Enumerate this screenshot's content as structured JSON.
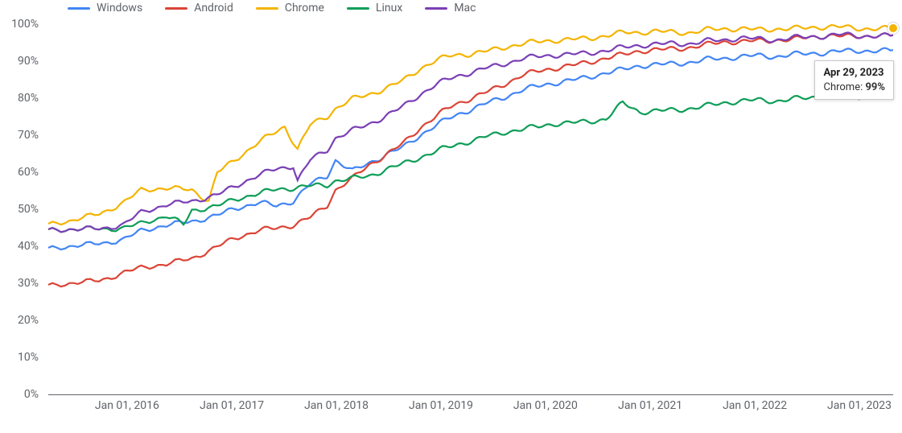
{
  "chart_data": {
    "type": "line",
    "xlabel": "",
    "ylabel": "",
    "ylim": [
      0,
      100
    ],
    "y_ticks": [
      "0%",
      "10%",
      "20%",
      "30%",
      "40%",
      "50%",
      "60%",
      "70%",
      "80%",
      "90%",
      "100%"
    ],
    "x_ticks": [
      "Jan 01, 2016",
      "Jan 01, 2017",
      "Jan 01, 2018",
      "Jan 01, 2019",
      "Jan 01, 2020",
      "Jan 01, 2021",
      "Jan 01, 2022",
      "Jan 01, 2023"
    ],
    "x_range": [
      "2015-04-01",
      "2023-04-29"
    ],
    "colors": {
      "Windows": "#4285F4",
      "Android": "#DB4437",
      "Chrome": "#F4B400",
      "Linux": "#0F9D58",
      "Mac": "#7B3FB5"
    },
    "legend": [
      "Windows",
      "Android",
      "Chrome",
      "Linux",
      "Mac"
    ],
    "series": [
      {
        "name": "Windows",
        "color": "#4285F4",
        "values": [
          [
            0.0,
            39
          ],
          [
            0.03,
            40
          ],
          [
            0.06,
            41
          ],
          [
            0.09,
            42
          ],
          [
            0.11,
            44
          ],
          [
            0.14,
            45.5
          ],
          [
            0.17,
            47
          ],
          [
            0.2,
            48.5
          ],
          [
            0.22,
            50
          ],
          [
            0.25,
            51.5
          ],
          [
            0.27,
            51
          ],
          [
            0.29,
            52.5
          ],
          [
            0.31,
            57
          ],
          [
            0.33,
            59
          ],
          [
            0.34,
            63
          ],
          [
            0.36,
            60
          ],
          [
            0.38,
            62.5
          ],
          [
            0.4,
            65
          ],
          [
            0.42,
            67
          ],
          [
            0.44,
            70
          ],
          [
            0.46,
            72.5
          ],
          [
            0.48,
            75
          ],
          [
            0.5,
            77
          ],
          [
            0.52,
            79
          ],
          [
            0.54,
            80.5
          ],
          [
            0.56,
            82
          ],
          [
            0.58,
            83
          ],
          [
            0.6,
            84
          ],
          [
            0.62,
            85
          ],
          [
            0.64,
            86
          ],
          [
            0.66,
            87
          ],
          [
            0.68,
            87.5
          ],
          [
            0.7,
            88.5
          ],
          [
            0.72,
            89
          ],
          [
            0.74,
            89.5
          ],
          [
            0.76,
            90
          ],
          [
            0.78,
            90.5
          ],
          [
            0.8,
            90.5
          ],
          [
            0.82,
            91
          ],
          [
            0.84,
            91.5
          ],
          [
            0.86,
            91.5
          ],
          [
            0.88,
            92
          ],
          [
            0.9,
            92
          ],
          [
            0.92,
            92
          ],
          [
            0.94,
            92.5
          ],
          [
            0.96,
            93
          ],
          [
            0.98,
            93
          ],
          [
            1.0,
            93
          ]
        ]
      },
      {
        "name": "Android",
        "color": "#DB4437",
        "values": [
          [
            0.0,
            29
          ],
          [
            0.03,
            30
          ],
          [
            0.06,
            31
          ],
          [
            0.09,
            33
          ],
          [
            0.11,
            34
          ],
          [
            0.14,
            35
          ],
          [
            0.17,
            37
          ],
          [
            0.2,
            40
          ],
          [
            0.22,
            42
          ],
          [
            0.25,
            44
          ],
          [
            0.27,
            45
          ],
          [
            0.29,
            46
          ],
          [
            0.31,
            48
          ],
          [
            0.33,
            51
          ],
          [
            0.34,
            55
          ],
          [
            0.36,
            58
          ],
          [
            0.38,
            62
          ],
          [
            0.4,
            65
          ],
          [
            0.42,
            68
          ],
          [
            0.44,
            72
          ],
          [
            0.46,
            75
          ],
          [
            0.48,
            78
          ],
          [
            0.5,
            80
          ],
          [
            0.52,
            82
          ],
          [
            0.54,
            84
          ],
          [
            0.56,
            86
          ],
          [
            0.58,
            87
          ],
          [
            0.6,
            88
          ],
          [
            0.62,
            89
          ],
          [
            0.64,
            90
          ],
          [
            0.66,
            91
          ],
          [
            0.68,
            91.5
          ],
          [
            0.7,
            92.5
          ],
          [
            0.72,
            93
          ],
          [
            0.74,
            93.5
          ],
          [
            0.76,
            94
          ],
          [
            0.78,
            94.5
          ],
          [
            0.8,
            95
          ],
          [
            0.82,
            95
          ],
          [
            0.84,
            95.5
          ],
          [
            0.86,
            96
          ],
          [
            0.88,
            96
          ],
          [
            0.9,
            96.5
          ],
          [
            0.92,
            96.5
          ],
          [
            0.94,
            96.5
          ],
          [
            0.96,
            97
          ],
          [
            0.98,
            97
          ],
          [
            1.0,
            97
          ]
        ]
      },
      {
        "name": "Chrome",
        "color": "#F4B400",
        "values": [
          [
            0.0,
            45.5
          ],
          [
            0.03,
            47
          ],
          [
            0.06,
            49
          ],
          [
            0.09,
            52
          ],
          [
            0.11,
            55
          ],
          [
            0.14,
            55.5
          ],
          [
            0.17,
            55.5
          ],
          [
            0.19,
            52.5
          ],
          [
            0.2,
            60
          ],
          [
            0.22,
            63
          ],
          [
            0.25,
            68
          ],
          [
            0.27,
            71
          ],
          [
            0.28,
            72.5
          ],
          [
            0.295,
            66.5
          ],
          [
            0.31,
            73
          ],
          [
            0.33,
            75
          ],
          [
            0.34,
            77
          ],
          [
            0.36,
            79.5
          ],
          [
            0.38,
            81
          ],
          [
            0.4,
            83
          ],
          [
            0.42,
            85
          ],
          [
            0.44,
            88
          ],
          [
            0.46,
            90
          ],
          [
            0.48,
            91.5
          ],
          [
            0.5,
            92
          ],
          [
            0.52,
            93
          ],
          [
            0.54,
            94
          ],
          [
            0.56,
            94.5
          ],
          [
            0.58,
            95
          ],
          [
            0.6,
            95.5
          ],
          [
            0.62,
            96
          ],
          [
            0.64,
            96.5
          ],
          [
            0.66,
            97
          ],
          [
            0.68,
            97.5
          ],
          [
            0.7,
            97.5
          ],
          [
            0.72,
            98
          ],
          [
            0.74,
            98
          ],
          [
            0.76,
            98
          ],
          [
            0.78,
            98.5
          ],
          [
            0.8,
            98.5
          ],
          [
            0.82,
            98.5
          ],
          [
            0.84,
            98.5
          ],
          [
            0.86,
            99
          ],
          [
            0.88,
            99
          ],
          [
            0.9,
            99
          ],
          [
            0.92,
            99
          ],
          [
            0.94,
            99
          ],
          [
            0.96,
            99
          ],
          [
            0.98,
            99
          ],
          [
            1.0,
            99
          ]
        ]
      },
      {
        "name": "Linux",
        "color": "#0F9D58",
        "values": [
          [
            0.0,
            44
          ],
          [
            0.03,
            44.5
          ],
          [
            0.06,
            45
          ],
          [
            0.09,
            45
          ],
          [
            0.11,
            46
          ],
          [
            0.14,
            48
          ],
          [
            0.16,
            46
          ],
          [
            0.17,
            50
          ],
          [
            0.2,
            51
          ],
          [
            0.22,
            52.5
          ],
          [
            0.25,
            54
          ],
          [
            0.27,
            55.5
          ],
          [
            0.29,
            56
          ],
          [
            0.31,
            56.5
          ],
          [
            0.33,
            56.5
          ],
          [
            0.34,
            57.5
          ],
          [
            0.36,
            58
          ],
          [
            0.38,
            59
          ],
          [
            0.4,
            61
          ],
          [
            0.42,
            62.5
          ],
          [
            0.44,
            64
          ],
          [
            0.46,
            65.5
          ],
          [
            0.48,
            67
          ],
          [
            0.5,
            68.5
          ],
          [
            0.52,
            70
          ],
          [
            0.54,
            71
          ],
          [
            0.56,
            71.5
          ],
          [
            0.58,
            72
          ],
          [
            0.6,
            73
          ],
          [
            0.62,
            73.5
          ],
          [
            0.64,
            74
          ],
          [
            0.66,
            74.5
          ],
          [
            0.68,
            78.5
          ],
          [
            0.7,
            76
          ],
          [
            0.72,
            76.5
          ],
          [
            0.74,
            77
          ],
          [
            0.76,
            77.5
          ],
          [
            0.78,
            78
          ],
          [
            0.8,
            78.5
          ],
          [
            0.82,
            79
          ],
          [
            0.84,
            79.5
          ],
          [
            0.86,
            79.5
          ],
          [
            0.88,
            80
          ],
          [
            0.9,
            80
          ],
          [
            0.92,
            80.5
          ],
          [
            0.94,
            80.5
          ],
          [
            0.96,
            80.5
          ],
          [
            0.98,
            81
          ],
          [
            1.0,
            81
          ]
        ]
      },
      {
        "name": "Mac",
        "color": "#7B3FB5",
        "values": [
          [
            0.0,
            44
          ],
          [
            0.03,
            44.5
          ],
          [
            0.06,
            45
          ],
          [
            0.09,
            46
          ],
          [
            0.11,
            49
          ],
          [
            0.14,
            51
          ],
          [
            0.17,
            52.5
          ],
          [
            0.2,
            54
          ],
          [
            0.22,
            56
          ],
          [
            0.25,
            59
          ],
          [
            0.27,
            61
          ],
          [
            0.29,
            62
          ],
          [
            0.295,
            58
          ],
          [
            0.31,
            63.5
          ],
          [
            0.33,
            66
          ],
          [
            0.34,
            69
          ],
          [
            0.36,
            71
          ],
          [
            0.38,
            73
          ],
          [
            0.4,
            75.5
          ],
          [
            0.42,
            78
          ],
          [
            0.44,
            81
          ],
          [
            0.46,
            83.5
          ],
          [
            0.48,
            85.5
          ],
          [
            0.5,
            87
          ],
          [
            0.52,
            88.5
          ],
          [
            0.54,
            89.5
          ],
          [
            0.56,
            90.5
          ],
          [
            0.58,
            91
          ],
          [
            0.6,
            91.5
          ],
          [
            0.62,
            92
          ],
          [
            0.64,
            92.5
          ],
          [
            0.66,
            93
          ],
          [
            0.68,
            93.5
          ],
          [
            0.7,
            94
          ],
          [
            0.72,
            94.5
          ],
          [
            0.74,
            95
          ],
          [
            0.76,
            95
          ],
          [
            0.78,
            95.5
          ],
          [
            0.8,
            95.5
          ],
          [
            0.82,
            96
          ],
          [
            0.84,
            96
          ],
          [
            0.86,
            96
          ],
          [
            0.88,
            96.5
          ],
          [
            0.9,
            96.5
          ],
          [
            0.92,
            96.5
          ],
          [
            0.94,
            97
          ],
          [
            0.96,
            97
          ],
          [
            0.98,
            97
          ],
          [
            1.0,
            97
          ]
        ]
      }
    ],
    "tooltip": {
      "date": "Apr 29, 2023",
      "series_label": "Chrome: ",
      "value": "99%",
      "marker_color": "#F4B400",
      "marker_point": [
        1.0,
        99
      ]
    }
  }
}
